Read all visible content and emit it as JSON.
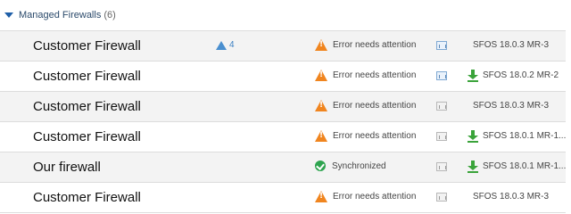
{
  "group": {
    "title": "Managed Firewalls",
    "count": "(6)"
  },
  "rows": [
    {
      "name": "Customer Firewall",
      "alert_count": "4",
      "status": "Error needs attention",
      "status_type": "error",
      "report_active": true,
      "download": false,
      "version": "SFOS 18.0.3 MR-3"
    },
    {
      "name": "Customer Firewall",
      "alert_count": "",
      "status": "Error needs attention",
      "status_type": "error",
      "report_active": true,
      "download": true,
      "version": "SFOS 18.0.2 MR-2"
    },
    {
      "name": "Customer Firewall",
      "alert_count": "",
      "status": "Error needs attention",
      "status_type": "error",
      "report_active": false,
      "download": false,
      "version": "SFOS 18.0.3 MR-3"
    },
    {
      "name": "Customer Firewall",
      "alert_count": "",
      "status": "Error needs attention",
      "status_type": "error",
      "report_active": false,
      "download": true,
      "version": "SFOS 18.0.1 MR-1..."
    },
    {
      "name": "Our firewall",
      "alert_count": "",
      "status": "Synchronized",
      "status_type": "ok",
      "report_active": false,
      "download": true,
      "version": "SFOS 18.0.1 MR-1..."
    },
    {
      "name": "Customer Firewall",
      "alert_count": "",
      "status": "Error needs attention",
      "status_type": "error",
      "report_active": false,
      "download": false,
      "version": "SFOS 18.0.3 MR-3"
    }
  ],
  "colors": {
    "error": "#f0851f",
    "ok": "#2ea44f",
    "download": "#3aa33a",
    "alert": "#4a8fcf"
  }
}
